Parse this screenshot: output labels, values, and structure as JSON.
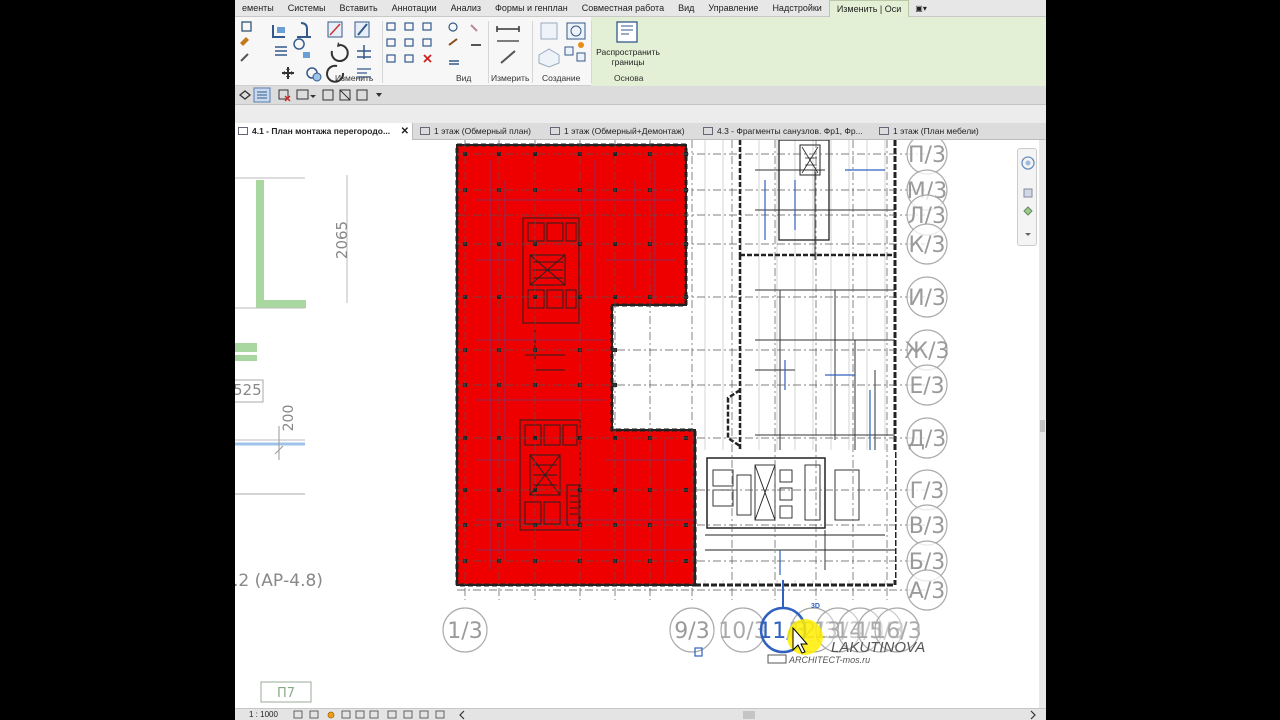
{
  "ribbon_tabs": [
    "ементы",
    "Системы",
    "Вставить",
    "Аннотации",
    "Анализ",
    "Формы и генплан",
    "Совместная работа",
    "Вид",
    "Управление",
    "Надстройки",
    "Изменить | Оси"
  ],
  "ribbon_tab_dropdown": "▣▾",
  "panels": {
    "modify": "Изменить",
    "view": "Вид",
    "measure": "Измерить",
    "create": "Создание",
    "basis": "Основа"
  },
  "propagate_button": "Распространить\nграницы",
  "doc_tabs": [
    {
      "label": "4.1 - План монтажа перегородо...",
      "active": true
    },
    {
      "label": "1 этаж (Обмерный план)",
      "active": false
    },
    {
      "label": "1 этаж (Обмерный+Демонтаж)",
      "active": false
    },
    {
      "label": "4.3 - Фрагменты санузлов. Фр1, Фр...",
      "active": false
    },
    {
      "label": "1 этаж (План мебели)",
      "active": false
    }
  ],
  "doc_tab_close": "✕",
  "left_view": {
    "dim_vertical": "2065",
    "dim_525": "525",
    "dim_200": "200",
    "ref_label": ".2 (АР-4.8)",
    "tag": "П7"
  },
  "grid_right": [
    "П/3",
    "М/3",
    "Л/3",
    "К/3",
    "И/3",
    "Ж/3",
    "Е/3",
    "Д/3",
    "Г/3",
    "В/3",
    "Б/3",
    "А/3"
  ],
  "grid_bottom": [
    "1/3",
    "9/3",
    "10/3",
    "11/3",
    "12/3",
    "13/3",
    "14/3",
    "15/3",
    "16/3"
  ],
  "label_3d": "3D",
  "watermark": {
    "name": "LAKUTINOVA",
    "site": "ARCHITECT-mos.ru"
  },
  "status": {
    "scale": "1 : 1000"
  },
  "colors": {
    "fill_area": "#ee0000",
    "accent_context": "#e3f0d5",
    "grid_blue": "#3060c0"
  }
}
